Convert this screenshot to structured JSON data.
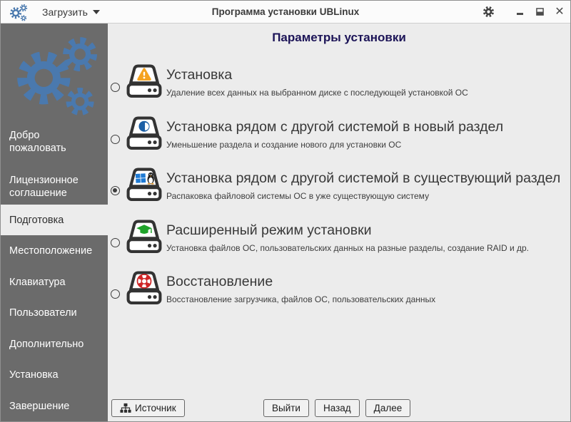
{
  "titlebar": {
    "app_icon": "gears-icon",
    "load_button": "Загрузить",
    "title": "Программа установки UBLinux",
    "settings_icon": "gear-icon",
    "minimize": "minimize",
    "maximize": "maximize",
    "close": "close"
  },
  "sidebar": {
    "logo_icon": "gears-logo-icon",
    "items": [
      {
        "label": "Добро пожаловать",
        "active": false
      },
      {
        "label": "Лицензионное соглашение",
        "active": false
      },
      {
        "label": "Подготовка",
        "active": true
      },
      {
        "label": "Местоположение",
        "active": false
      },
      {
        "label": "Клавиатура",
        "active": false
      },
      {
        "label": "Пользователи",
        "active": false
      },
      {
        "label": "Дополнительно",
        "active": false
      },
      {
        "label": "Установка",
        "active": false
      },
      {
        "label": "Завершение",
        "active": false
      }
    ]
  },
  "main": {
    "title": "Параметры установки",
    "options": [
      {
        "icon": "drive-warning-icon",
        "title": "Установка",
        "description": "Удаление всех данных на выбранном диске с последующей установкой ОС",
        "selected": false
      },
      {
        "icon": "drive-partition-icon",
        "title": "Установка рядом с другой системой в новый раздел",
        "description": "Уменьшение раздела и создание нового для установки ОС",
        "selected": false
      },
      {
        "icon": "drive-dualboot-icon",
        "title": "Установка рядом с другой системой в существующий раздел",
        "description": "Распаковка файловой системы ОС в уже существующую систему",
        "selected": true
      },
      {
        "icon": "drive-graduation-icon",
        "title": "Расширенный режим установки",
        "description": "Установка файлов ОС, пользовательских данных на разные разделы, создание RAID и др.",
        "selected": false
      },
      {
        "icon": "drive-lifebuoy-icon",
        "title": "Восстановление",
        "description": "Восстановление загрузчика, файлов ОС, пользовательских данных",
        "selected": false
      }
    ],
    "footer": {
      "source": "Источник",
      "exit": "Выйти",
      "back": "Назад",
      "next": "Далее"
    }
  },
  "colors": {
    "accent_blue": "#4a79ae",
    "warning_orange": "#f5a321",
    "partition_blue": "#1b5fa6",
    "windows_blue": "#1e7ad4",
    "cap_green": "#1fa32a",
    "lifebuoy_red": "#cf2526",
    "title_navy": "#1c1457",
    "sidebar_gray": "#6b6b6b"
  }
}
